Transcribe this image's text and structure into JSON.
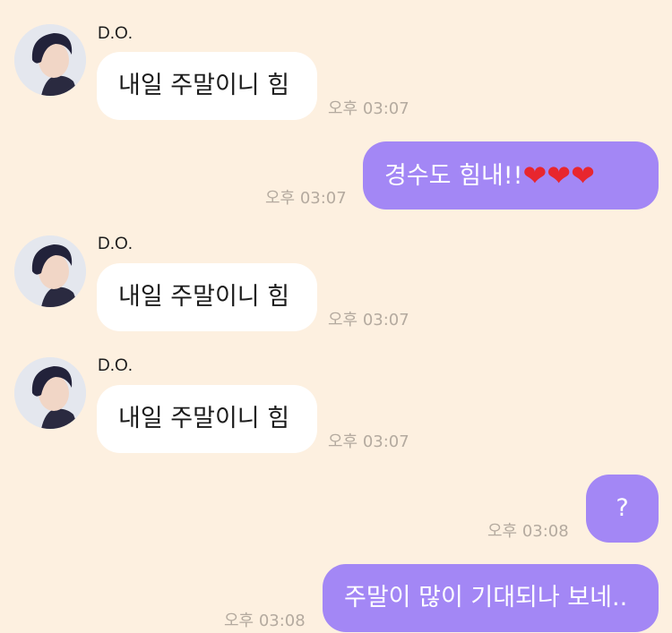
{
  "messages": [
    {
      "sender": "D.O.",
      "text": "내일 주말이니 힘",
      "time": "오후 03:07"
    },
    {
      "text": "경수도 힘내!!",
      "hearts": [
        "❤",
        "❤",
        "❤"
      ],
      "time": "오후 03:07"
    },
    {
      "sender": "D.O.",
      "text": "내일 주말이니 힘",
      "time": "오후 03:07"
    },
    {
      "sender": "D.O.",
      "text": "내일 주말이니 힘",
      "time": "오후 03:07"
    },
    {
      "text": "?",
      "time": "오후 03:08"
    },
    {
      "text": "주말이 많이 기대되나 보네..",
      "time": "오후 03:08"
    }
  ],
  "icons": {
    "avatar": "profile-photo",
    "heart": "red-heart-emoji"
  },
  "colors": {
    "background": "#fdf0e0",
    "incoming_bubble": "#ffffff",
    "outgoing_bubble": "#a387f5",
    "timestamp": "#b4aa9f",
    "heart": "#e8262e"
  }
}
